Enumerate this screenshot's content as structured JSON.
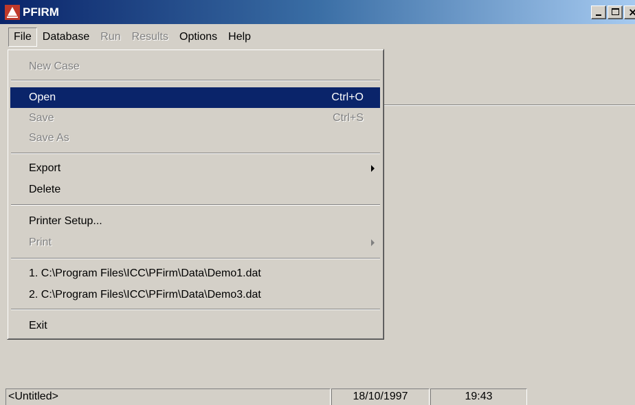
{
  "window": {
    "title": "PFIRM",
    "icon": "pfirm-app-icon",
    "controls": [
      "minimize-icon",
      "maximize-icon",
      "close-icon"
    ],
    "close_glyph": "×"
  },
  "menubar": {
    "items": [
      {
        "label": "File",
        "enabled": true,
        "active": true
      },
      {
        "label": "Database",
        "enabled": true
      },
      {
        "label": "Run",
        "enabled": false
      },
      {
        "label": "Results",
        "enabled": false
      },
      {
        "label": "Options",
        "enabled": true
      },
      {
        "label": "Help",
        "enabled": true
      }
    ]
  },
  "file_menu": {
    "new_case": {
      "label": "New Case",
      "enabled": false
    },
    "open": {
      "label": "Open",
      "shortcut": "Ctrl+O",
      "enabled": true,
      "selected": true
    },
    "save": {
      "label": "Save",
      "shortcut": "Ctrl+S",
      "enabled": false
    },
    "save_as": {
      "label": "Save As",
      "enabled": false
    },
    "export": {
      "label": "Export",
      "enabled": true,
      "has_submenu": true
    },
    "delete": {
      "label": "Delete",
      "enabled": true
    },
    "printer_setup": {
      "label": "Printer Setup...",
      "enabled": true
    },
    "print": {
      "label": "Print",
      "enabled": false,
      "has_submenu": true
    },
    "recent_1": {
      "label": "1. C:\\Program Files\\ICC\\PFirm\\Data\\Demo1.dat",
      "enabled": true
    },
    "recent_2": {
      "label": "2. C:\\Program Files\\ICC\\PFirm\\Data\\Demo3.dat",
      "enabled": true
    },
    "exit": {
      "label": "Exit",
      "enabled": true
    }
  },
  "statusbar": {
    "document": "<Untitled>",
    "date": "18/10/1997",
    "time": "19:43"
  },
  "colors": {
    "face": "#d4d0c8",
    "highlight": "#0a246a",
    "titlebar_start": "#0a246a",
    "titlebar_end": "#a6caf0",
    "disabled_text": "#808080",
    "icon_red": "#c0392b"
  }
}
